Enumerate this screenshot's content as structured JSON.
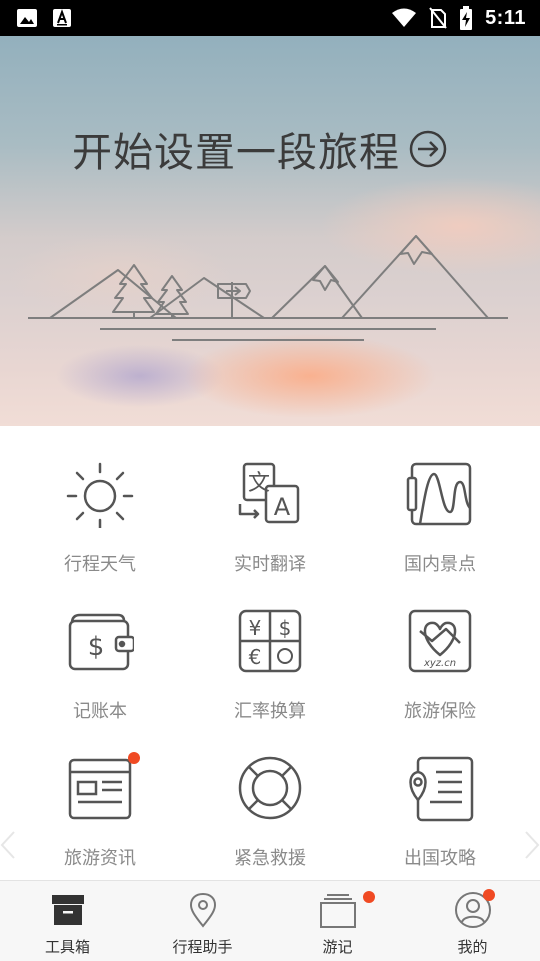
{
  "status_bar": {
    "time": "5:11"
  },
  "hero": {
    "title": "开始设置一段旅程"
  },
  "tools": [
    {
      "label": "行程天气",
      "icon": "sun-icon",
      "badge": false
    },
    {
      "label": "实时翻译",
      "icon": "translate-icon",
      "badge": false
    },
    {
      "label": "国内景点",
      "icon": "landscape-icon",
      "badge": false
    },
    {
      "label": "记账本",
      "icon": "wallet-icon",
      "badge": false
    },
    {
      "label": "汇率换算",
      "icon": "currency-exchange-icon",
      "badge": false
    },
    {
      "label": "旅游保险",
      "icon": "insurance-heart-icon",
      "badge": false
    },
    {
      "label": "旅游资讯",
      "icon": "news-icon",
      "badge": true
    },
    {
      "label": "紧急救援",
      "icon": "lifebuoy-icon",
      "badge": false
    },
    {
      "label": "出国攻略",
      "icon": "guide-map-icon",
      "badge": false
    }
  ],
  "insurance_logo_text": "xyz.cn",
  "tabbar": {
    "items": [
      {
        "label": "工具箱",
        "icon": "toolbox-icon",
        "active": true,
        "badge": false
      },
      {
        "label": "行程助手",
        "icon": "location-pin-icon",
        "active": false,
        "badge": false
      },
      {
        "label": "游记",
        "icon": "photo-stack-icon",
        "active": false,
        "badge": true
      },
      {
        "label": "我的",
        "icon": "user-profile-icon",
        "active": false,
        "badge": true
      }
    ]
  },
  "colors": {
    "badge": "#f04a23",
    "icon": "#555555",
    "label": "#8a8a8a"
  }
}
